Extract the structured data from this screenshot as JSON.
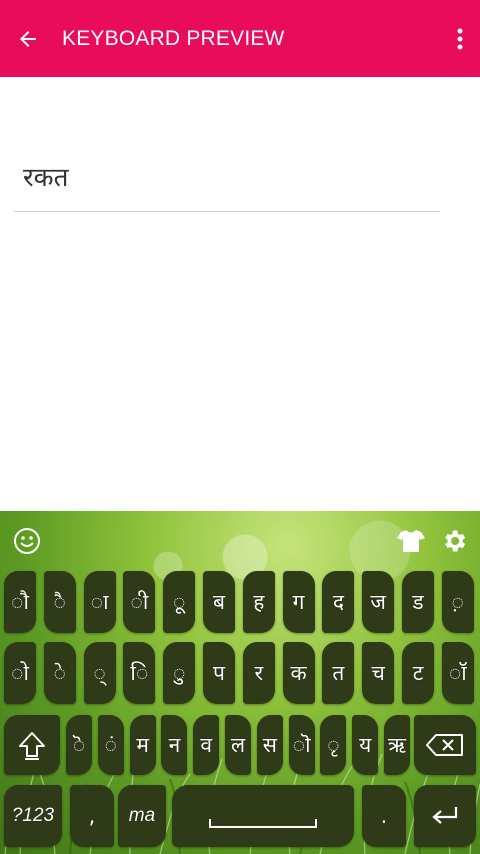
{
  "appbar": {
    "title": "KEYBOARD PREVIEW",
    "back_icon": "arrow-left-icon",
    "more_icon": "more-vertical-icon",
    "color": "#e90c5a"
  },
  "field": {
    "value": "रकत"
  },
  "keyboard": {
    "toolbar": {
      "emoji_icon": "emoji-icon",
      "theme_icon": "tshirt-icon",
      "settings_icon": "gear-icon"
    },
    "row1": [
      "ौ",
      "ै",
      "ा",
      "ी",
      "ू",
      "ब",
      "ह",
      "ग",
      "द",
      "ज",
      "ड",
      "़"
    ],
    "row2": [
      "ो",
      "े",
      "्",
      "ि",
      "ु",
      "प",
      "र",
      "क",
      "त",
      "च",
      "ट",
      "ॉ"
    ],
    "row3": [
      "ॆ",
      "ं",
      "म",
      "न",
      "व",
      "ल",
      "स",
      "ॊ",
      "ृ",
      "य",
      "ऋ"
    ],
    "shift_icon": "shift-icon",
    "backspace_icon": "backspace-icon",
    "bottom": {
      "sym_label": "?123",
      "comma_label": ",",
      "lang_label": "ma",
      "period_label": ".",
      "enter_icon": "enter-icon"
    },
    "colors": {
      "key": "#2f3a18",
      "bg": "#8fc23b"
    }
  }
}
